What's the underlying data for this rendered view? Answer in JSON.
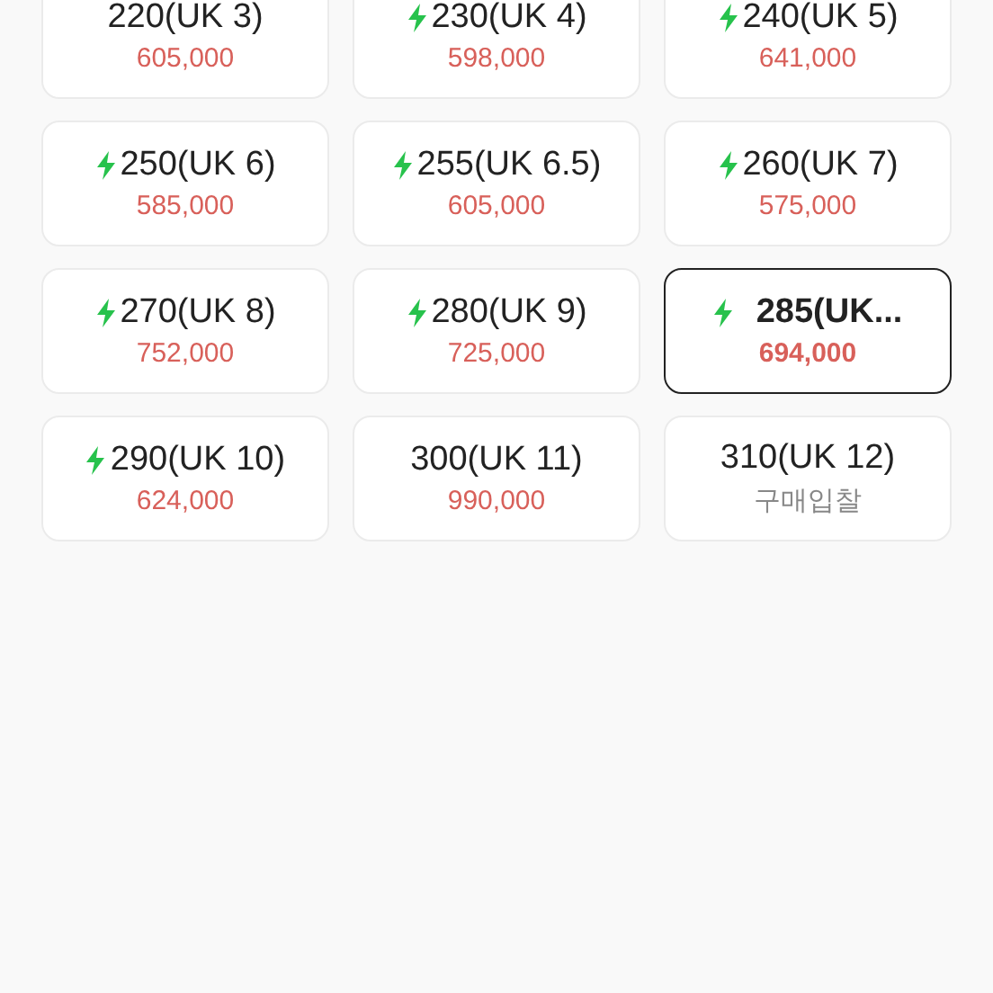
{
  "sizes": [
    {
      "label": "220(UK 3)",
      "express": false,
      "kind": "price",
      "price": "605,000",
      "selected": false
    },
    {
      "label": "230(UK 4)",
      "express": true,
      "kind": "price",
      "price": "598,000",
      "selected": false
    },
    {
      "label": "240(UK 5)",
      "express": true,
      "kind": "price",
      "price": "641,000",
      "selected": false
    },
    {
      "label": "250(UK 6)",
      "express": true,
      "kind": "price",
      "price": "585,000",
      "selected": false
    },
    {
      "label": "255(UK 6.5)",
      "express": true,
      "kind": "price",
      "price": "605,000",
      "selected": false
    },
    {
      "label": "260(UK 7)",
      "express": true,
      "kind": "price",
      "price": "575,000",
      "selected": false
    },
    {
      "label": "270(UK 8)",
      "express": true,
      "kind": "price",
      "price": "752,000",
      "selected": false
    },
    {
      "label": "280(UK 9)",
      "express": true,
      "kind": "price",
      "price": "725,000",
      "selected": false
    },
    {
      "label": "285(UK...",
      "express": true,
      "kind": "price",
      "price": "694,000",
      "selected": true
    },
    {
      "label": "290(UK 10)",
      "express": true,
      "kind": "price",
      "price": "624,000",
      "selected": false
    },
    {
      "label": "300(UK 11)",
      "express": false,
      "kind": "price",
      "price": "990,000",
      "selected": false
    },
    {
      "label": "310(UK 12)",
      "express": false,
      "kind": "bid",
      "price": "구매입찰",
      "selected": false
    }
  ]
}
